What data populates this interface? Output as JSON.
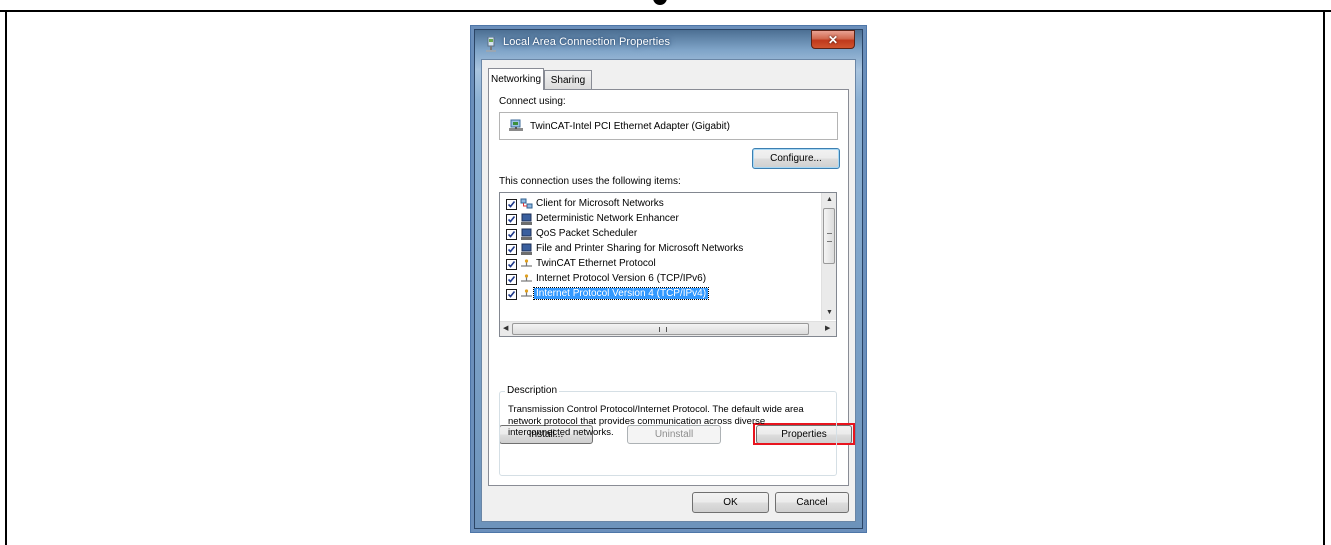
{
  "dialog": {
    "title": "Local Area Connection Properties",
    "close_glyph": "✕",
    "tabs": [
      {
        "label": "Networking",
        "active": true
      },
      {
        "label": "Sharing",
        "active": false
      }
    ],
    "connect_using_label": "Connect using:",
    "adapter_name": "TwinCAT-Intel PCI Ethernet Adapter (Gigabit)",
    "configure_button": "Configure...",
    "items_label": "This connection uses the following items:",
    "items": [
      {
        "label": "Client for Microsoft Networks",
        "checked": true,
        "icon": "network-client-icon"
      },
      {
        "label": "Deterministic Network Enhancer",
        "checked": true,
        "icon": "network-service-icon"
      },
      {
        "label": "QoS Packet Scheduler",
        "checked": true,
        "icon": "network-service-icon"
      },
      {
        "label": "File and Printer Sharing for Microsoft Networks",
        "checked": true,
        "icon": "network-service-icon"
      },
      {
        "label": "TwinCAT Ethernet Protocol",
        "checked": true,
        "icon": "protocol-icon"
      },
      {
        "label": "Internet Protocol Version 6 (TCP/IPv6)",
        "checked": true,
        "icon": "protocol-icon"
      },
      {
        "label": "Internet Protocol Version 4 (TCP/IPv4)",
        "checked": true,
        "icon": "protocol-icon",
        "selected": true
      }
    ],
    "install_button": "Install...",
    "uninstall_button": "Uninstall",
    "properties_button": "Properties",
    "description_legend": "Description",
    "description_text": "Transmission Control Protocol/Internet Protocol. The default wide area network protocol that provides communication across diverse interconnected networks.",
    "ok_button": "OK",
    "cancel_button": "Cancel"
  },
  "colors": {
    "highlight": "#e8141e",
    "selection": "#3399ff",
    "title_glass": "#7fa4c8",
    "close_button": "#c0391c"
  }
}
